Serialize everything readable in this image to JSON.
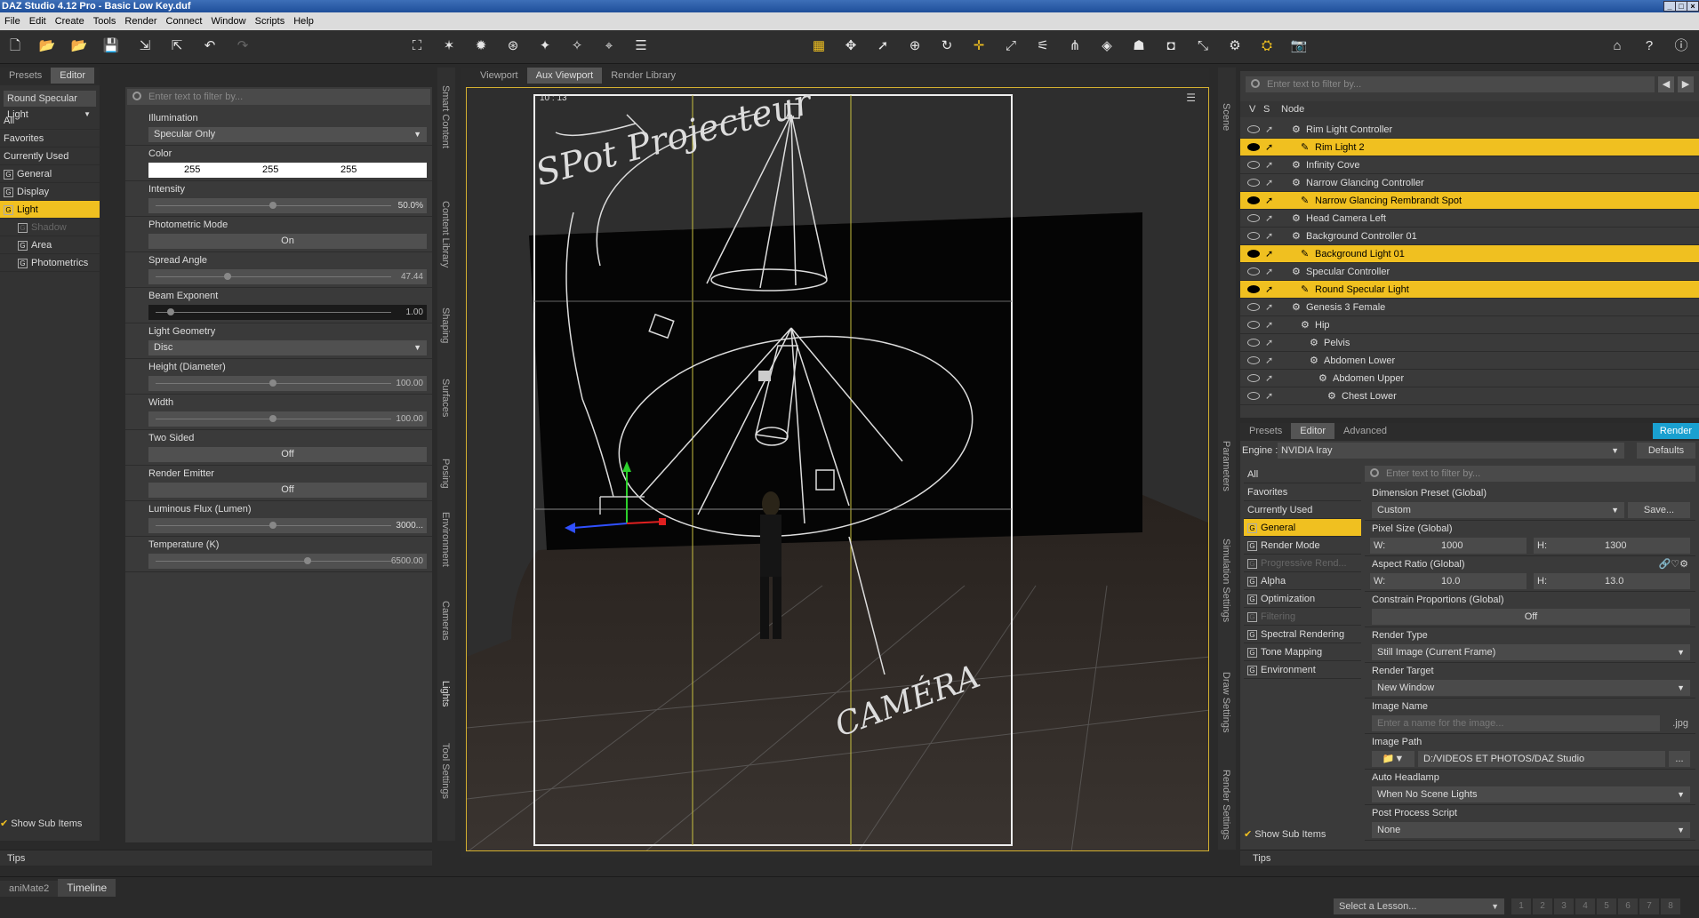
{
  "window": {
    "title": "DAZ Studio 4.12 Pro - Basic Low Key.duf",
    "btn_min": "_",
    "btn_max": "□",
    "btn_close": "×"
  },
  "menu": [
    "File",
    "Edit",
    "Create",
    "Tools",
    "Render",
    "Connect",
    "Window",
    "Scripts",
    "Help"
  ],
  "left_panel": {
    "tabs": [
      "Presets",
      "Editor"
    ],
    "node_select": "Round Specular Light",
    "filter_placeholder": "Enter text to filter by...",
    "categories": [
      {
        "label": "All",
        "level": 0,
        "state": "normal"
      },
      {
        "label": "Favorites",
        "level": 0,
        "state": "normal"
      },
      {
        "label": "Currently Used",
        "level": 0,
        "state": "normal"
      },
      {
        "label": "General",
        "level": 0,
        "state": "normal"
      },
      {
        "label": "Display",
        "level": 0,
        "state": "normal"
      },
      {
        "label": "Light",
        "level": 0,
        "state": "selected"
      },
      {
        "label": "Shadow",
        "level": 1,
        "state": "dim"
      },
      {
        "label": "Area",
        "level": 1,
        "state": "normal"
      },
      {
        "label": "Photometrics",
        "level": 1,
        "state": "normal"
      }
    ],
    "show_sub_items": "Show Sub Items",
    "tips": "Tips"
  },
  "light_props": {
    "illumination": {
      "label": "Illumination",
      "value": "Specular Only"
    },
    "color": {
      "label": "Color",
      "r": "255",
      "g": "255",
      "b": "255"
    },
    "intensity": {
      "label": "Intensity",
      "value": "50.0%",
      "fraction": 0.5
    },
    "photometric": {
      "label": "Photometric Mode",
      "value": "On"
    },
    "spread": {
      "label": "Spread Angle",
      "value": "47.44",
      "fraction": 0.3
    },
    "beam": {
      "label": "Beam Exponent",
      "value": "1.00",
      "fraction": 0.05
    },
    "geometry": {
      "label": "Light Geometry",
      "value": "Disc"
    },
    "height": {
      "label": "Height (Diameter)",
      "value": "100.00",
      "fraction": 0.5
    },
    "width": {
      "label": "Width",
      "value": "100.00",
      "fraction": 0.5
    },
    "two_sided": {
      "label": "Two Sided",
      "value": "Off"
    },
    "emitter": {
      "label": "Render Emitter",
      "value": "Off"
    },
    "flux": {
      "label": "Luminous Flux (Lumen)",
      "value": "3000...",
      "fraction": 0.5
    },
    "temperature": {
      "label": "Temperature (K)",
      "value": "6500.00",
      "fraction": 0.65
    }
  },
  "left_vtabs": [
    "Smart Content",
    "Content Library",
    "Shaping",
    "Surfaces",
    "Posing",
    "Environment",
    "Cameras",
    "Lights",
    "Tool Settings"
  ],
  "viewport": {
    "tabs": [
      "Viewport",
      "Aux Viewport",
      "Render Library"
    ],
    "aspect": "10 : 13",
    "ann_spot": "SPot Projecteur",
    "ann_camera": "CAMÉRA"
  },
  "scene": {
    "tab": "Scene",
    "filter_placeholder": "Enter text to filter by...",
    "col_v": "V",
    "col_s": "S",
    "col_node": "Node",
    "nodes": [
      {
        "label": "Rim Light Controller",
        "depth": 0,
        "sel": false
      },
      {
        "label": "Rim Light 2",
        "depth": 1,
        "sel": true
      },
      {
        "label": "Infinity Cove",
        "depth": 0,
        "sel": false
      },
      {
        "label": "Narrow Glancing Controller",
        "depth": 0,
        "sel": false
      },
      {
        "label": "Narrow Glancing Rembrandt Spot",
        "depth": 1,
        "sel": true
      },
      {
        "label": "Head Camera Left",
        "depth": 0,
        "sel": false
      },
      {
        "label": "Background Controller 01",
        "depth": 0,
        "sel": false
      },
      {
        "label": "Background Light 01",
        "depth": 1,
        "sel": true
      },
      {
        "label": "Specular Controller",
        "depth": 0,
        "sel": false
      },
      {
        "label": "Round Specular Light",
        "depth": 1,
        "sel": true
      },
      {
        "label": "Genesis 3 Female",
        "depth": 0,
        "sel": false
      },
      {
        "label": "Hip",
        "depth": 1,
        "sel": false
      },
      {
        "label": "Pelvis",
        "depth": 2,
        "sel": false
      },
      {
        "label": "Abdomen Lower",
        "depth": 2,
        "sel": false
      },
      {
        "label": "Abdomen Upper",
        "depth": 3,
        "sel": false
      },
      {
        "label": "Chest Lower",
        "depth": 4,
        "sel": false
      }
    ]
  },
  "render": {
    "tabs": [
      "Presets",
      "Editor",
      "Advanced"
    ],
    "render_btn": "Render",
    "engine_label": "Engine :",
    "engine": "NVIDIA Iray",
    "defaults": "Defaults",
    "categories": [
      {
        "label": "All",
        "state": "normal"
      },
      {
        "label": "Favorites",
        "state": "normal"
      },
      {
        "label": "Currently Used",
        "state": "normal"
      },
      {
        "label": "General",
        "state": "selected"
      },
      {
        "label": "Render Mode",
        "state": "normal"
      },
      {
        "label": "Progressive Rend...",
        "state": "dim"
      },
      {
        "label": "Alpha",
        "state": "normal"
      },
      {
        "label": "Optimization",
        "state": "normal"
      },
      {
        "label": "Filtering",
        "state": "dim"
      },
      {
        "label": "Spectral Rendering",
        "state": "normal"
      },
      {
        "label": "Tone Mapping",
        "state": "normal"
      },
      {
        "label": "Environment",
        "state": "normal"
      }
    ],
    "filter_placeholder": "Enter text to filter by...",
    "dimension_preset": {
      "label": "Dimension Preset (Global)",
      "value": "Custom",
      "save": "Save..."
    },
    "pixel_size": {
      "label": "Pixel Size (Global)",
      "w_label": "W:",
      "w": "1000",
      "h_label": "H:",
      "h": "1300"
    },
    "aspect_ratio": {
      "label": "Aspect Ratio (Global)",
      "w_label": "W:",
      "w": "10.0",
      "h_label": "H:",
      "h": "13.0"
    },
    "constrain": {
      "label": "Constrain Proportions (Global)",
      "value": "Off"
    },
    "render_type": {
      "label": "Render Type",
      "value": "Still Image (Current Frame)"
    },
    "render_target": {
      "label": "Render Target",
      "value": "New Window"
    },
    "image_name": {
      "label": "Image Name",
      "placeholder": "Enter a name for the image...",
      "ext": ".jpg"
    },
    "image_path": {
      "label": "Image Path",
      "value": "D:/VIDEOS ET PHOTOS/DAZ Studio",
      "more": "..."
    },
    "headlamp": {
      "label": "Auto Headlamp",
      "value": "When No Scene Lights"
    },
    "post_script": {
      "label": "Post Process Script",
      "value": "None"
    },
    "show_sub_items": "Show Sub Items",
    "tips": "Tips",
    "vtabs": [
      "Parameters",
      "Simulation Settings",
      "Draw Settings",
      "Render Settings"
    ]
  },
  "bottom": {
    "tabs": [
      "aniMate2",
      "Timeline"
    ],
    "lesson": "Select a Lesson...",
    "pages": [
      "1",
      "2",
      "3",
      "4",
      "5",
      "6",
      "7",
      "8"
    ]
  }
}
